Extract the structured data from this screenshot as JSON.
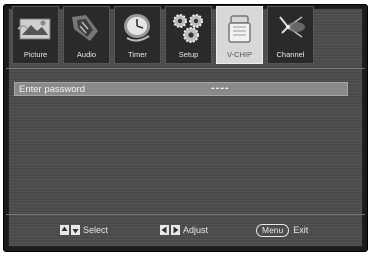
{
  "tabs": [
    {
      "label": "Picture",
      "icon": "picture-icon"
    },
    {
      "label": "Audio",
      "icon": "audio-icon"
    },
    {
      "label": "Timer",
      "icon": "timer-icon"
    },
    {
      "label": "Setup",
      "icon": "setup-icon"
    },
    {
      "label": "V-CHIP",
      "icon": "vchip-icon"
    },
    {
      "label": "Channel",
      "icon": "channel-icon"
    }
  ],
  "active_tab": "V-CHIP",
  "password": {
    "label": "Enter password",
    "value": "----"
  },
  "footer": {
    "select_label": "Select",
    "adjust_label": "Adjust",
    "menu_key": "Menu",
    "exit_label": "Exit"
  }
}
